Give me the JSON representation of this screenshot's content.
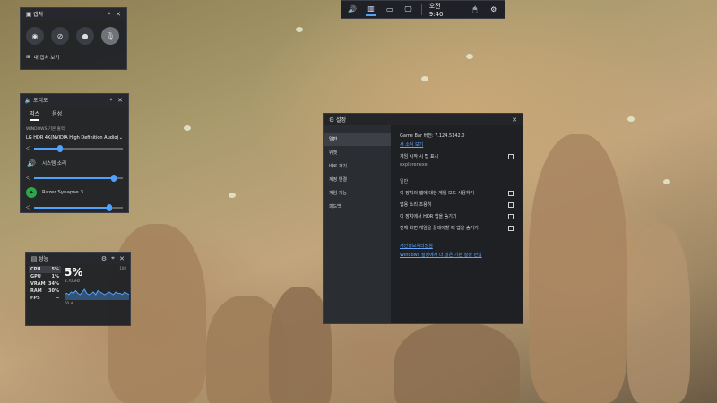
{
  "topbar": {
    "icons": [
      "volume-icon",
      "performance-icon",
      "monitor-icon",
      "screen-icon",
      "controller-icon"
    ],
    "time": "오전 9:40",
    "extra_icons": [
      "mouse-icon",
      "settings-icon"
    ]
  },
  "capture": {
    "title": "캡처",
    "buttons": [
      "camera-icon",
      "record-off-icon",
      "record-dot-icon",
      "mic-icon"
    ],
    "show_all": "내 캡처 보기"
  },
  "audio": {
    "title": "오디오",
    "tabs": [
      "믹스",
      "음성"
    ],
    "default_output_label": "WINDOWS 기본 출력",
    "device": "LG HDR 4K(NVIDIA High Definition Audio)",
    "master_level": 0.3,
    "mixer": [
      {
        "name": "시스템 소리",
        "level": 0.9
      },
      {
        "name": "Razer Synapse 3",
        "level": 0.85
      }
    ]
  },
  "performance": {
    "title": "성능",
    "stats": [
      {
        "label": "CPU",
        "value": "5%"
      },
      {
        "label": "GPU",
        "value": "1%"
      },
      {
        "label": "VRAM",
        "value": "34%"
      },
      {
        "label": "RAM",
        "value": "30%"
      },
      {
        "label": "FPS",
        "value": "--"
      }
    ],
    "big_value": "5%",
    "big_sub": "3.70GHz",
    "scale_max": "100",
    "span_label": "60 초",
    "series": [
      4,
      5,
      4,
      6,
      5,
      7,
      5,
      4,
      6,
      8,
      5,
      4,
      5,
      6,
      4,
      7,
      6,
      5,
      4,
      5,
      6,
      5,
      4,
      6,
      5,
      5,
      4,
      6,
      5,
      4
    ]
  },
  "settings": {
    "title": "설정",
    "nav": [
      "일반",
      "위젯",
      "바로 가기",
      "계정 연결",
      "게임 기능",
      "피드백"
    ],
    "selected_nav": 0,
    "version": "Game Bar 버전: 7.124.5142.0",
    "whats_new": "새 소식 보기",
    "show_tips": "게임 시작 시 팁 표시",
    "exe": "explorer.exe",
    "general_header": "일반",
    "options": [
      "이 장치의 앱에 대한 게임 모드 사용하기",
      "앱용 소리 조용히",
      "이 장치에서 HDR 앱을 숨기기",
      "전체 화면 게임을 플레이할 때 앱을 숨기기"
    ],
    "privacy_link": "개인정보처리방침",
    "windows_link": "Windows 설정에서 더 많은 기본 설정 편집"
  }
}
